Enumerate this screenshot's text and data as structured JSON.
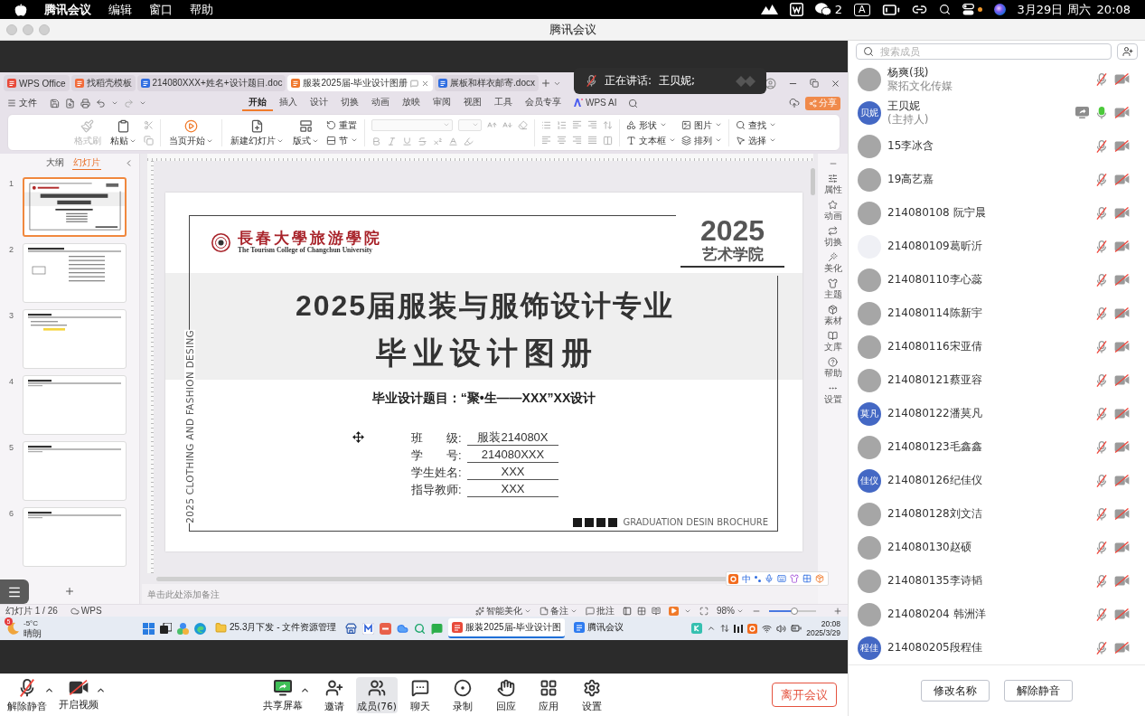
{
  "menubar": {
    "app": "腾讯会议",
    "menus": [
      "编辑",
      "窗口",
      "帮助"
    ],
    "chat_count": "2",
    "input_mode": "A",
    "date": "3月29日 周六",
    "time": "20:08"
  },
  "window": {
    "title": "腾讯会议"
  },
  "speaking": {
    "label": "正在讲话:",
    "names": "王贝妮;"
  },
  "wps": {
    "tabs": [
      {
        "label": "WPS Office",
        "kind": "home",
        "selected": false
      },
      {
        "label": "找稻壳模板",
        "kind": "template",
        "selected": false
      },
      {
        "label": "214080XXX+姓名+设计题目.doc",
        "kind": "document",
        "selected": false
      },
      {
        "label": "服装2025届-毕业设计图册",
        "kind": "presentation",
        "selected": true
      },
      {
        "label": "展板和样衣邮寄.docx",
        "kind": "document",
        "selected": false
      }
    ],
    "file_menu": "文件",
    "ribbon_tabs": [
      {
        "label": "开始",
        "kind": "text",
        "selected": true
      },
      {
        "label": "插入",
        "kind": "text",
        "selected": false
      },
      {
        "label": "设计",
        "kind": "text",
        "selected": false
      },
      {
        "label": "切换",
        "kind": "text",
        "selected": false
      },
      {
        "label": "动画",
        "kind": "text",
        "selected": false
      },
      {
        "label": "放映",
        "kind": "text",
        "selected": false
      },
      {
        "label": "审阅",
        "kind": "text",
        "selected": false
      },
      {
        "label": "视图",
        "kind": "text",
        "selected": false
      },
      {
        "label": "工具",
        "kind": "text",
        "selected": false
      },
      {
        "label": "会员专享",
        "kind": "text",
        "selected": false
      },
      {
        "label": "WPS AI",
        "kind": "ai",
        "selected": false
      }
    ],
    "share_button": "分享",
    "ribbon": {
      "clipboard": [
        {
          "label": "格式刷",
          "disabled": true,
          "dropdown": false
        },
        {
          "label": "粘贴",
          "disabled": false,
          "dropdown": true
        }
      ],
      "play": {
        "label": "当页开始",
        "dropdown": true
      },
      "slides": [
        {
          "label": "新建幻灯片",
          "dropdown": true
        },
        {
          "label": "版式",
          "dropdown": true
        },
        {
          "label": "重置",
          "dropdown": false
        },
        {
          "label": "节",
          "dropdown": true
        }
      ],
      "insert": [
        {
          "label": "形状",
          "dropdown": true
        },
        {
          "label": "文本框",
          "dropdown": true
        },
        {
          "label": "图片",
          "dropdown": true
        },
        {
          "label": "排列",
          "dropdown": true
        }
      ],
      "find": [
        {
          "label": "查找",
          "dropdown": true
        },
        {
          "label": "选择",
          "dropdown": true
        }
      ]
    },
    "panel_tabs": [
      {
        "label": "大纲",
        "selected": false
      },
      {
        "label": "幻灯片",
        "selected": true
      }
    ],
    "thumbnails": [
      {
        "number": "1",
        "selected": true
      },
      {
        "number": "2",
        "selected": false
      },
      {
        "number": "3",
        "selected": false
      },
      {
        "number": "4",
        "selected": false
      },
      {
        "number": "5",
        "selected": false
      },
      {
        "number": "6",
        "selected": false
      }
    ],
    "slide": {
      "college_name": "長春大學旅游學院",
      "college_name_en": "The Tourism College of Changchun University",
      "year": "2025",
      "school": "艺术学院",
      "title": [
        "2025届服装与服饰设计专业",
        "毕业设计图册"
      ],
      "topic": "毕业设计题目：“聚•生——XXX”XX设计",
      "fields": [
        {
          "label": "班　　级:",
          "value": "服装214080X"
        },
        {
          "label": "学　　号:",
          "value": "214080XXX"
        },
        {
          "label": "学生姓名:",
          "value": "XXX"
        },
        {
          "label": "指导教师:",
          "value": "XXX"
        }
      ],
      "side_text": "2025 CLOTHING AND FASHION DESING",
      "footer": "GRADUATION DESIN BROCHURE"
    },
    "side_tools": [
      "属性",
      "动画",
      "切换",
      "美化",
      "主题",
      "素材",
      "文库",
      "帮助",
      "设置"
    ],
    "notes": {
      "placeholder": "单击此处添加备注"
    },
    "status_bar": {
      "slide_info": "幻灯片 1 / 26",
      "cloud": "WPS",
      "beautify": "智能美化",
      "notes": "备注",
      "comments": "批注",
      "zoom": "98%",
      "zoom_slider": {
        "level": 0.53
      }
    }
  },
  "ime_bar": {
    "mode": "中"
  },
  "taskbar": {
    "weather": {
      "badge": "5",
      "temperature": "-5°C",
      "condition": "晴朗"
    },
    "windows": [
      {
        "label": "25.3月下发 - 文件资源管理",
        "kind": "folder",
        "selected": false
      },
      {
        "label": "服装2025届-毕业设计图",
        "kind": "wps",
        "selected": true
      },
      {
        "label": "腾讯会议",
        "kind": "meeting",
        "selected": false
      }
    ],
    "time": "20:08",
    "date": "2025/3/29"
  },
  "members": {
    "search_placeholder": "搜索成员",
    "list": [
      {
        "name": "杨爽(我)",
        "subtitle": "聚拓文化传媒",
        "avatar": {
          "kind": "image"
        },
        "sharing": false,
        "mic_on": false,
        "camera_on": false
      },
      {
        "name": "王贝妮",
        "subtitle": "(主持人)",
        "avatar": {
          "kind": "text",
          "text": "贝妮"
        },
        "sharing": true,
        "mic_on": true,
        "camera_on": false
      },
      {
        "name": "15李冰含",
        "avatar": {
          "kind": "image"
        },
        "sharing": false,
        "mic_on": false,
        "camera_on": false
      },
      {
        "name": "19高艺嘉",
        "avatar": {
          "kind": "image"
        },
        "sharing": false,
        "mic_on": false,
        "camera_on": false
      },
      {
        "name": "214080108 阮宁晨",
        "avatar": {
          "kind": "image"
        },
        "sharing": false,
        "mic_on": false,
        "camera_on": false
      },
      {
        "name": "214080109葛昕沂",
        "avatar": {
          "kind": "blank"
        },
        "sharing": false,
        "mic_on": false,
        "camera_on": false
      },
      {
        "name": "214080110李心蕊",
        "avatar": {
          "kind": "image"
        },
        "sharing": false,
        "mic_on": false,
        "camera_on": false
      },
      {
        "name": "214080114陈新宇",
        "avatar": {
          "kind": "image"
        },
        "sharing": false,
        "mic_on": false,
        "camera_on": false
      },
      {
        "name": "214080116宋亚倩",
        "avatar": {
          "kind": "image"
        },
        "sharing": false,
        "mic_on": false,
        "camera_on": false
      },
      {
        "name": "214080121蔡亚容",
        "avatar": {
          "kind": "image"
        },
        "sharing": false,
        "mic_on": false,
        "camera_on": false
      },
      {
        "name": "214080122潘莫凡",
        "avatar": {
          "kind": "text",
          "text": "莫凡"
        },
        "sharing": false,
        "mic_on": false,
        "camera_on": false
      },
      {
        "name": "214080123毛鑫鑫",
        "avatar": {
          "kind": "image"
        },
        "sharing": false,
        "mic_on": false,
        "camera_on": false
      },
      {
        "name": "214080126纪佳仪",
        "avatar": {
          "kind": "text",
          "text": "佳仪"
        },
        "sharing": false,
        "mic_on": false,
        "camera_on": false
      },
      {
        "name": "214080128刘文洁",
        "avatar": {
          "kind": "image"
        },
        "sharing": false,
        "mic_on": false,
        "camera_on": false
      },
      {
        "name": "214080130赵硕",
        "avatar": {
          "kind": "image"
        },
        "sharing": false,
        "mic_on": false,
        "camera_on": false
      },
      {
        "name": "214080135李诗韬",
        "avatar": {
          "kind": "image"
        },
        "sharing": false,
        "mic_on": false,
        "camera_on": false
      },
      {
        "name": "214080204 韩洲洋",
        "avatar": {
          "kind": "image"
        },
        "sharing": false,
        "mic_on": false,
        "camera_on": false
      },
      {
        "name": "214080205段程佳",
        "avatar": {
          "kind": "text",
          "text": "程佳"
        },
        "sharing": false,
        "mic_on": false,
        "camera_on": false
      }
    ],
    "buttons": [
      "修改名称",
      "解除静音"
    ]
  },
  "toolbar": {
    "left": [
      {
        "label": "解除静音",
        "kind": "unmute",
        "menu": true,
        "selected": false
      },
      {
        "label": "开启视频",
        "kind": "video",
        "menu": true,
        "selected": false
      }
    ],
    "center": [
      {
        "label": "共享屏幕",
        "kind": "share",
        "menu": true,
        "selected": false
      },
      {
        "label": "邀请",
        "kind": "invite",
        "menu": false,
        "selected": false
      },
      {
        "label": "成员(76)",
        "kind": "members",
        "menu": false,
        "selected": true
      },
      {
        "label": "聊天",
        "kind": "chat",
        "menu": false,
        "selected": false
      },
      {
        "label": "录制",
        "kind": "record",
        "menu": false,
        "selected": false
      },
      {
        "label": "回应",
        "kind": "react",
        "menu": false,
        "selected": false
      },
      {
        "label": "应用",
        "kind": "apps",
        "menu": false,
        "selected": false
      },
      {
        "label": "设置",
        "kind": "settings",
        "menu": false,
        "selected": false
      }
    ],
    "leave_button": "离开会议"
  }
}
